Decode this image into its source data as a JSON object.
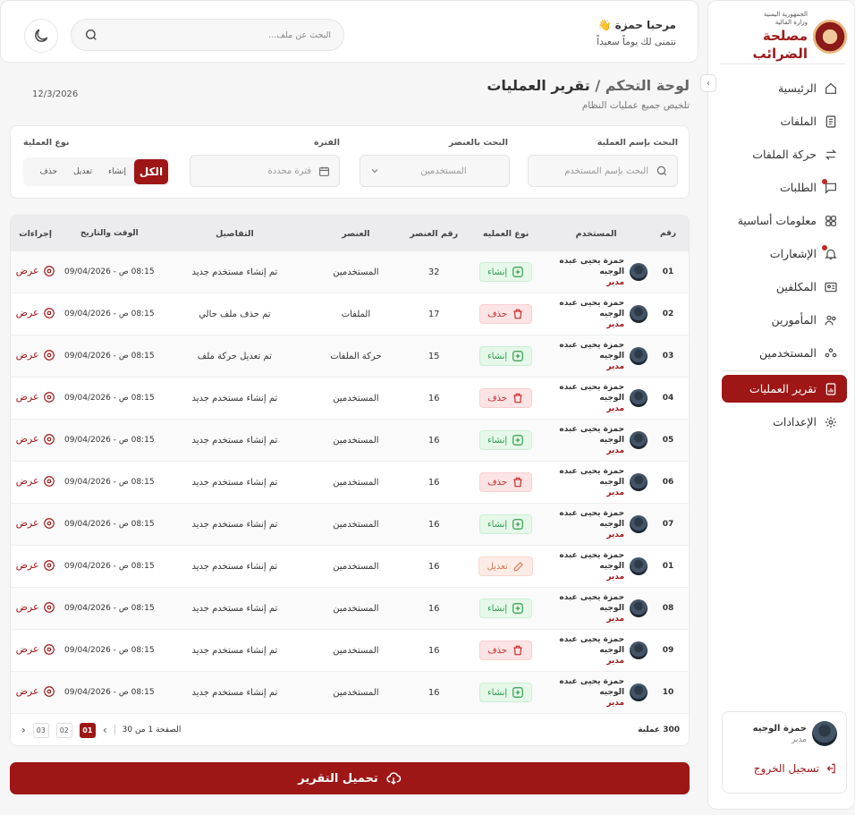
{
  "app": {
    "name": "مصلحة الضرائب",
    "logo_small_top": "الجمهورية اليمنية",
    "logo_small_bottom": "وزارة المالية"
  },
  "header": {
    "greeting": "مرحبا حمزة 👋",
    "greeting_sub": "نتمنى لك يوماً سعيداً",
    "search_placeholder": "البحث عن ملف..."
  },
  "sidebar": {
    "items": [
      {
        "label": "الرئيسية",
        "icon": "home-icon"
      },
      {
        "label": "الملفات",
        "icon": "files-icon"
      },
      {
        "label": "حركة الملفات",
        "icon": "transfer-icon"
      },
      {
        "label": "الطلبات",
        "icon": "requests-icon"
      },
      {
        "label": "معلومات أساسية",
        "icon": "grid-icon"
      },
      {
        "label": "الإشعارات",
        "icon": "bell-icon"
      },
      {
        "label": "المكلفين",
        "icon": "id-card-icon"
      },
      {
        "label": "المأمورين",
        "icon": "users-icon"
      },
      {
        "label": "المستخدمين",
        "icon": "group-icon"
      },
      {
        "label": "تقرير العمليات",
        "icon": "report-icon",
        "active": true
      },
      {
        "label": "الإعدادات",
        "icon": "gear-icon"
      }
    ],
    "user": {
      "name": "حمزة الوجيه",
      "role": "مدير",
      "logout": "تسجيل الخروج"
    }
  },
  "page": {
    "crumb_parent": "لوحة التحكم",
    "crumb_sep": "/",
    "title": "تقرير العمليات",
    "subtitle": "تلخيص جميع عمليات النظام",
    "date": "12/3/2026"
  },
  "filters": {
    "op_name_label": "البحث بإسم العملية",
    "op_name_placeholder": "البحث بإسم المستخدم",
    "element_label": "البحث بالعنصر",
    "element_value": "المستخدمين",
    "period_label": "الفترة",
    "period_placeholder": "فترة محددة",
    "type_label": "نوع العملية",
    "types": [
      "الكل",
      "إنشاء",
      "تعديل",
      "حذف"
    ]
  },
  "table": {
    "headers": [
      "رقم",
      "المستخدم",
      "نوع العمليه",
      "رقم العنصر",
      "العنصر",
      "التفاصيل",
      "الوقت والتاريخ",
      "إجراءات"
    ],
    "view_label": "عرض",
    "rows": [
      {
        "num": "01",
        "user": "حمزة يحيى عبده الوجيه",
        "role": "مدير",
        "op": "إنشاء",
        "op_type": "create",
        "el_no": "32",
        "el": "المستخدمين",
        "details": "تم إنشاء مستخدم جديد",
        "time": "08:15 ص - 09/04/2026"
      },
      {
        "num": "02",
        "user": "حمزة يحيى عبده الوجيه",
        "role": "مدير",
        "op": "حذف",
        "op_type": "delete",
        "el_no": "17",
        "el": "الملفات",
        "details": "تم حذف ملف حالي",
        "time": "08:15 ص - 09/04/2026"
      },
      {
        "num": "03",
        "user": "حمزة يحيى عبده الوجيه",
        "role": "مدير",
        "op": "إنشاء",
        "op_type": "create",
        "el_no": "15",
        "el": "حركة الملفات",
        "details": "تم تعديل حركة ملف",
        "time": "08:15 ص - 09/04/2026"
      },
      {
        "num": "04",
        "user": "حمزة يحيى عبده الوجيه",
        "role": "مدير",
        "op": "حذف",
        "op_type": "delete",
        "el_no": "16",
        "el": "المستخدمين",
        "details": "تم إنشاء مستخدم جديد",
        "time": "08:15 ص - 09/04/2026"
      },
      {
        "num": "05",
        "user": "حمزة يحيى عبده الوجيه",
        "role": "مدير",
        "op": "إنشاء",
        "op_type": "create",
        "el_no": "16",
        "el": "المستخدمين",
        "details": "تم إنشاء مستخدم جديد",
        "time": "08:15 ص - 09/04/2026"
      },
      {
        "num": "06",
        "user": "حمزة يحيى عبده الوجيه",
        "role": "مدير",
        "op": "حذف",
        "op_type": "delete",
        "el_no": "16",
        "el": "المستخدمين",
        "details": "تم إنشاء مستخدم جديد",
        "time": "08:15 ص - 09/04/2026"
      },
      {
        "num": "07",
        "user": "حمزة يحيى عبده الوجيه",
        "role": "مدير",
        "op": "إنشاء",
        "op_type": "create",
        "el_no": "16",
        "el": "المستخدمين",
        "details": "تم إنشاء مستخدم جديد",
        "time": "08:15 ص - 09/04/2026"
      },
      {
        "num": "01",
        "user": "حمزة يحيى عبده الوجيه",
        "role": "مدير",
        "op": "تعديل",
        "op_type": "edit",
        "el_no": "16",
        "el": "المستخدمين",
        "details": "تم إنشاء مستخدم جديد",
        "time": "08:15 ص - 09/04/2026"
      },
      {
        "num": "08",
        "user": "حمزة يحيى عبده الوجيه",
        "role": "مدير",
        "op": "إنشاء",
        "op_type": "create",
        "el_no": "16",
        "el": "المستخدمين",
        "details": "تم إنشاء مستخدم جديد",
        "time": "08:15 ص - 09/04/2026"
      },
      {
        "num": "09",
        "user": "حمزة يحيى عبده الوجيه",
        "role": "مدير",
        "op": "حذف",
        "op_type": "delete",
        "el_no": "16",
        "el": "المستخدمين",
        "details": "تم إنشاء مستخدم جديد",
        "time": "08:15 ص - 09/04/2026"
      },
      {
        "num": "10",
        "user": "حمزة يحيى عبده الوجيه",
        "role": "مدير",
        "op": "إنشاء",
        "op_type": "create",
        "el_no": "16",
        "el": "المستخدمين",
        "details": "تم إنشاء مستخدم جديد",
        "time": "08:15 ص - 09/04/2026"
      }
    ]
  },
  "pagination": {
    "total": "300 عملية",
    "info": "الصفحة 1 من 30",
    "pages": [
      "01",
      "02",
      "03"
    ],
    "current": "01"
  },
  "download": {
    "label": "تحميل التقرير"
  }
}
